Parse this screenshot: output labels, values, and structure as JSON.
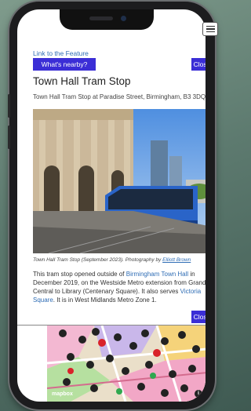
{
  "header": {
    "link_label": "Link to the Feature",
    "whats_nearby_label": "What's nearby?",
    "close_label": "Close"
  },
  "feature": {
    "title": "Town Hall Tram Stop",
    "subtitle": "Town Hall Tram Stop at Paradise Street, Birmingham, B3 3DQ",
    "caption_prefix": "Town Hall Tram Stop (September 2023). Photography by ",
    "caption_author": "Elliott Brown",
    "desc_1": "This tram stop opened outside of ",
    "desc_link_1": "Birmingham Town Hall",
    "desc_2": " in December 2019, on the Westside Metro extension from Grand Central to Library (Centenary Square). It also serves ",
    "desc_link_2": "Victoria Square",
    "desc_3": ". It is in West Midlands Metro Zone 1."
  },
  "footer": {
    "close_label": "Close"
  },
  "map": {
    "attribution": "mapbox",
    "info_symbol": "i"
  },
  "icons": {
    "menu": "hamburger-menu-icon",
    "info": "info-icon"
  },
  "colors": {
    "accent_button": "#3b2ed6",
    "link": "#2f6db5"
  }
}
